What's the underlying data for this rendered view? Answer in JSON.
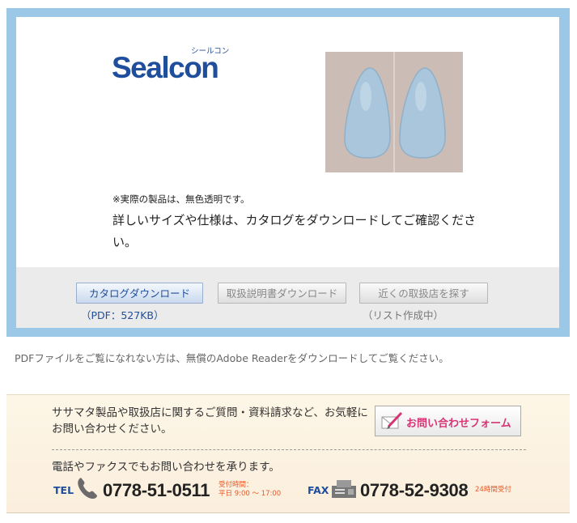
{
  "brand": {
    "logo_text": "Sealcon",
    "logo_kana": "シールコン"
  },
  "product": {
    "note": "※実際の製品は、無色透明です。",
    "description": "詳しいサイズや仕様は、カタログをダウンロードしてご確認ください。"
  },
  "buttons": {
    "catalog": {
      "label": "カタログダウンロード",
      "sub": "（PDF：527KB）"
    },
    "manual": {
      "label": "取扱説明書ダウンロード"
    },
    "store": {
      "label": "近くの取扱店を探す",
      "sub": "（リスト作成中）"
    }
  },
  "pdf_note": "PDFファイルをご覧になれない方は、無償のAdobe Readerをダウンロードしてご覧ください。",
  "contact": {
    "text": "ササマタ製品や取扱店に関するご質問・資料請求など、お気軽にお問い合わせください。",
    "form_button": "お問い合わせフォーム",
    "phone_lead": "電話やファクスでもお問い合わせを承ります。",
    "tel_label": "TEL",
    "tel_number": "0778-51-0511",
    "tel_hours_1": "受付時間：",
    "tel_hours_2": "平日 9:00 ～ 17:00",
    "fax_label": "FAX",
    "fax_number": "0778-52-9308",
    "fax_note": "24時間受付"
  },
  "colors": {
    "frame": "#9cc8e8",
    "brand_blue": "#1f4e9c",
    "accent_pink": "#d63575",
    "hours_orange": "#e85a2a"
  }
}
